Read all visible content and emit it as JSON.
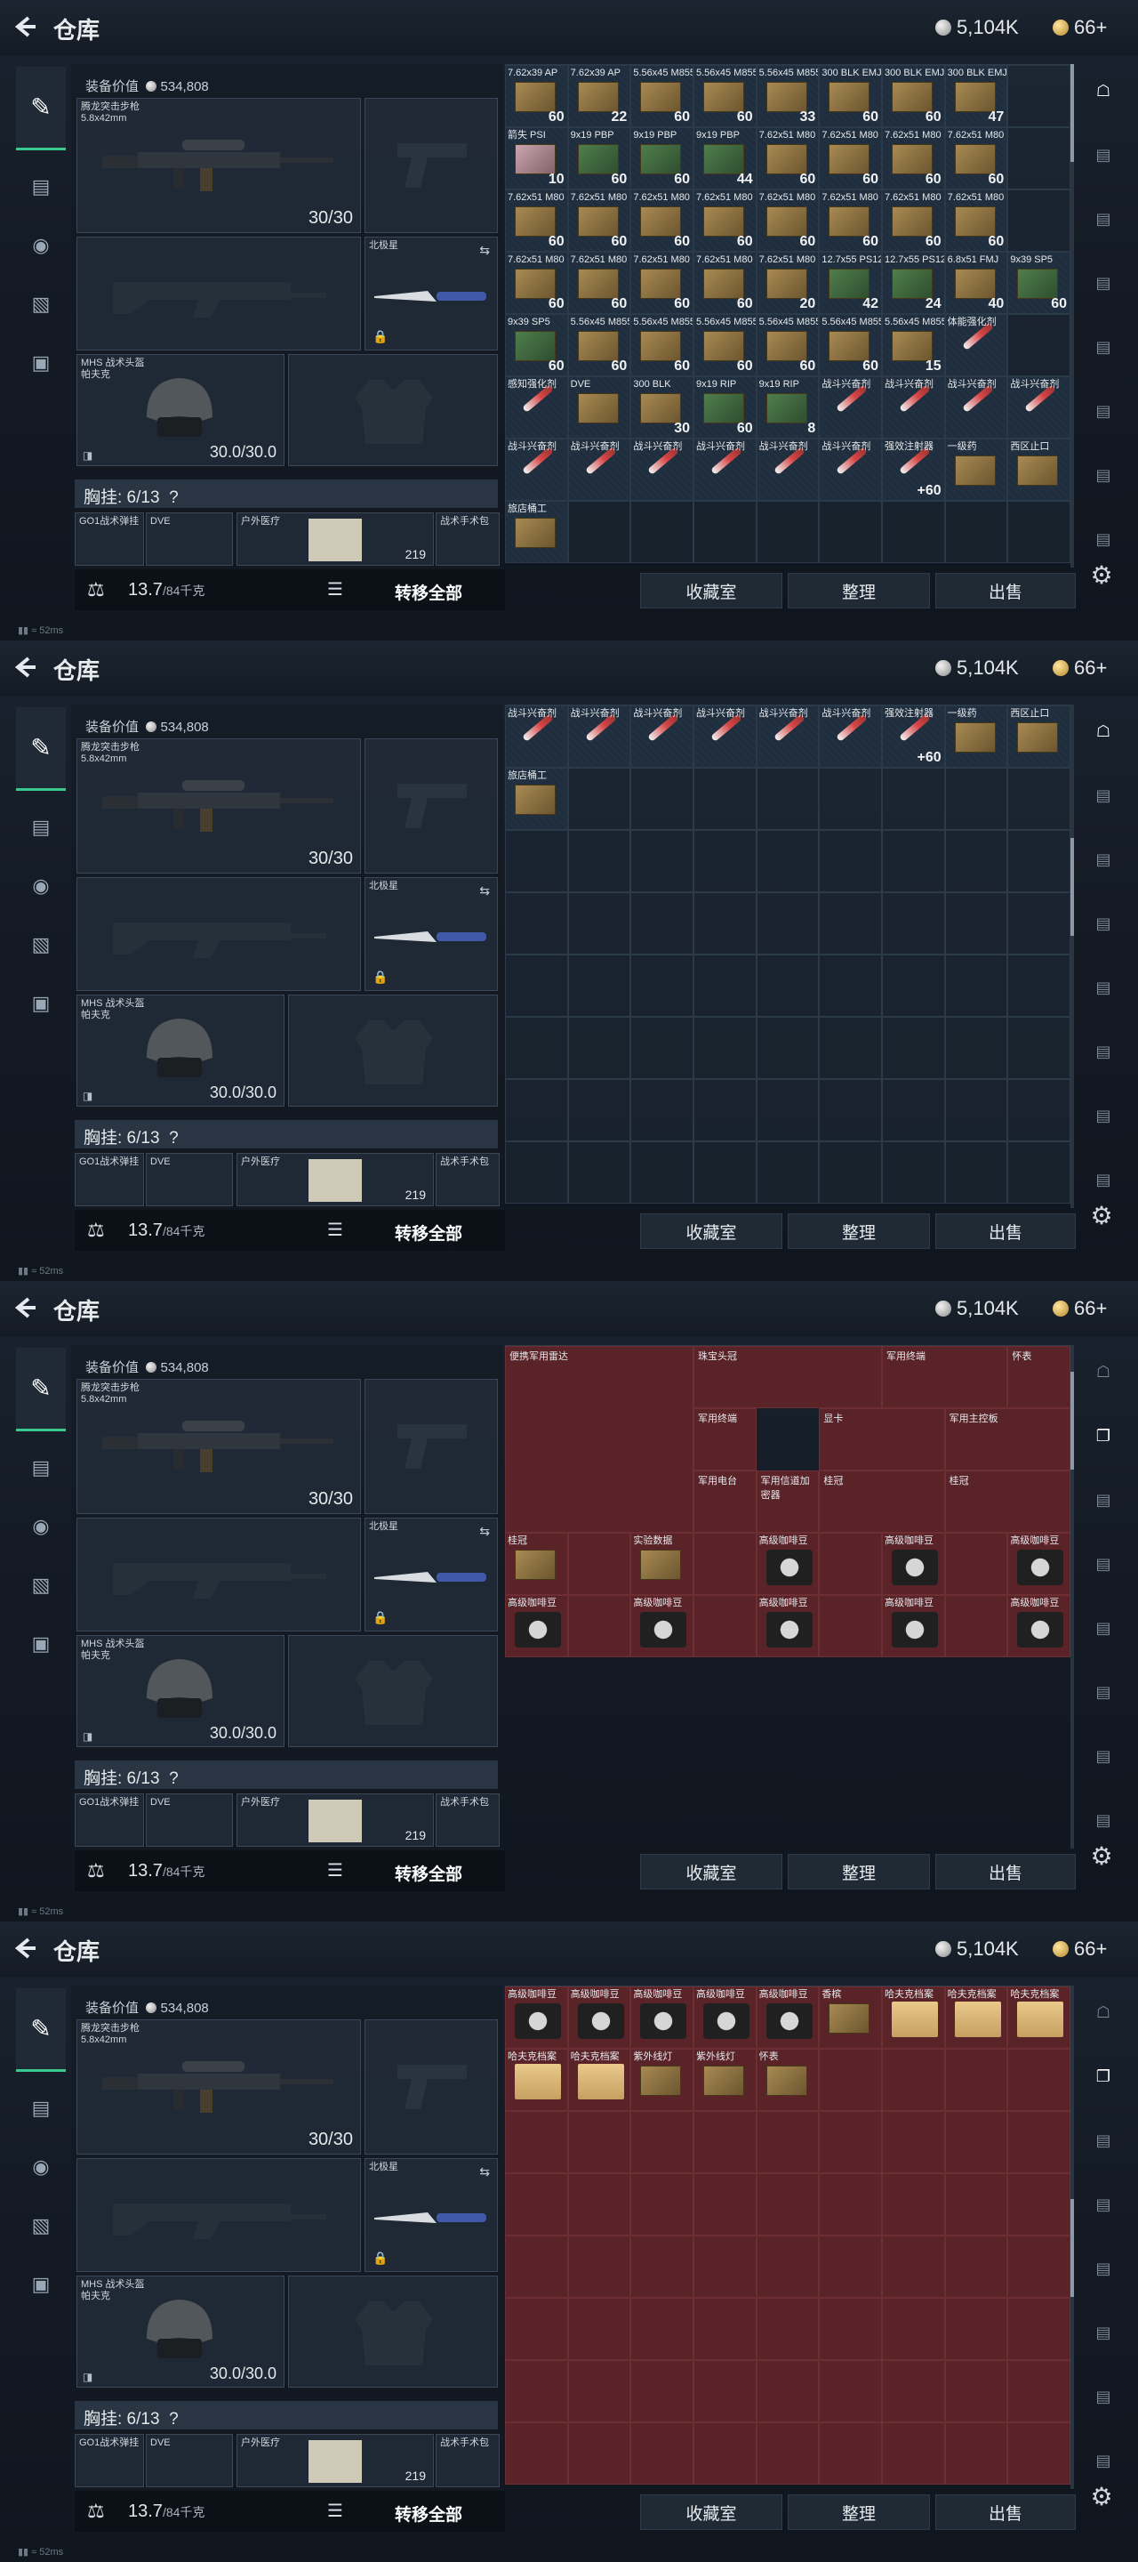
{
  "header": {
    "title": "仓库",
    "silver": "5,104K",
    "gold": "66+"
  },
  "loadout": {
    "value_label": "装备价值",
    "value": "534,808",
    "rifle_name": "腾龙突击步枪",
    "rifle_caliber": "5.8x42mm",
    "rifle_ammo": "30/30",
    "melee_label": "北极星",
    "helmet_name": "MHS 战术头盔",
    "helmet_sub": "帕夫克",
    "helmet_durability": "30.0/30.0",
    "chest_label": "胸挂: 6/13",
    "chest_q": "?",
    "rig_items": [
      "GO1战术弹挂",
      "DVE",
      "户外医疗",
      "战术手术包"
    ],
    "rig_count": "219",
    "weight": "13.7",
    "weight_max": "/84千克",
    "transfer_all": "转移全部"
  },
  "buttons": {
    "collection": "收藏室",
    "sort": "整理",
    "sell": "出售"
  },
  "status": {
    "ping": "52ms"
  },
  "panels": [
    {
      "cells": [
        [
          "7.62x39 AP",
          "60"
        ],
        [
          "7.62x39 AP",
          "22"
        ],
        [
          "5.56x45 M855",
          "60"
        ],
        [
          "5.56x45 M855",
          "60"
        ],
        [
          "5.56x45 M855",
          "33"
        ],
        [
          "300 BLK EMJ",
          "60"
        ],
        [
          "300 BLK EMJ",
          "60"
        ],
        [
          "300 BLK EMJ",
          "47"
        ],
        [
          "",
          ""
        ],
        [
          "箭失 PSI",
          "10"
        ],
        [
          "9x19 PBP",
          "60"
        ],
        [
          "9x19 PBP",
          "60"
        ],
        [
          "9x19 PBP",
          "44"
        ],
        [
          "7.62x51 M80",
          "60"
        ],
        [
          "7.62x51 M80",
          "60"
        ],
        [
          "7.62x51 M80",
          "60"
        ],
        [
          "7.62x51 M80",
          "60"
        ],
        [
          "",
          ""
        ],
        [
          "7.62x51 M80",
          "60"
        ],
        [
          "7.62x51 M80",
          "60"
        ],
        [
          "7.62x51 M80",
          "60"
        ],
        [
          "7.62x51 M80",
          "60"
        ],
        [
          "7.62x51 M80",
          "60"
        ],
        [
          "7.62x51 M80",
          "60"
        ],
        [
          "7.62x51 M80",
          "60"
        ],
        [
          "7.62x51 M80",
          "60"
        ],
        [
          "",
          ""
        ],
        [
          "7.62x51 M80",
          "60"
        ],
        [
          "7.62x51 M80",
          "60"
        ],
        [
          "7.62x51 M80",
          "60"
        ],
        [
          "7.62x51 M80",
          "60"
        ],
        [
          "7.62x51 M80",
          "20"
        ],
        [
          "12.7x55 PS12",
          "42"
        ],
        [
          "12.7x55 PS12",
          "24"
        ],
        [
          "6.8x51 FMJ",
          "40"
        ],
        [
          "9x39 SP5",
          "60"
        ],
        [
          "9x39 SP5",
          "60"
        ],
        [
          "5.56x45 M855A1",
          "60"
        ],
        [
          "5.56x45 M855A1",
          "60"
        ],
        [
          "5.56x45 M855A1",
          "60"
        ],
        [
          "5.56x45 M855A1",
          "60"
        ],
        [
          "5.56x45 M855A1",
          "60"
        ],
        [
          "5.56x45 M855A1",
          "15"
        ],
        [
          "体能强化剂",
          ""
        ],
        [
          "",
          ""
        ],
        [
          "感知强化剂",
          ""
        ],
        [
          "DVE",
          ""
        ],
        [
          "300 BLK",
          "30"
        ],
        [
          "9x19 RIP",
          "60"
        ],
        [
          "9x19 RIP",
          "8"
        ],
        [
          "战斗兴奋剂",
          ""
        ],
        [
          "战斗兴奋剂",
          ""
        ],
        [
          "战斗兴奋剂",
          ""
        ],
        [
          "战斗兴奋剂",
          ""
        ],
        [
          "战斗兴奋剂",
          ""
        ],
        [
          "战斗兴奋剂",
          ""
        ],
        [
          "战斗兴奋剂",
          ""
        ],
        [
          "战斗兴奋剂",
          ""
        ],
        [
          "战斗兴奋剂",
          ""
        ],
        [
          "战斗兴奋剂",
          ""
        ],
        [
          "强效注射器",
          "+60"
        ],
        [
          "一级药",
          ""
        ],
        [
          "西区止口",
          ""
        ],
        [
          "旅店桶工",
          ""
        ],
        [
          "",
          ""
        ],
        [
          "",
          ""
        ],
        [
          "",
          ""
        ],
        [
          "",
          ""
        ],
        [
          "",
          ""
        ],
        [
          "",
          ""
        ],
        [
          "",
          ""
        ],
        [
          "",
          ""
        ]
      ]
    },
    {
      "cells": [
        [
          "战斗兴奋剂",
          ""
        ],
        [
          "战斗兴奋剂",
          ""
        ],
        [
          "战斗兴奋剂",
          ""
        ],
        [
          "战斗兴奋剂",
          ""
        ],
        [
          "战斗兴奋剂",
          ""
        ],
        [
          "战斗兴奋剂",
          ""
        ],
        [
          "强效注射器",
          "+60"
        ],
        [
          "一级药",
          ""
        ],
        [
          "西区止口",
          ""
        ],
        [
          "旅店桶工",
          ""
        ]
      ]
    },
    {
      "big": [
        {
          "label": "便携军用雷达"
        },
        {
          "label": "珠宝头冠"
        },
        {
          "label": "军用终端"
        },
        {
          "label": "怀表"
        },
        {
          "label": "军用终端"
        },
        {
          "label": "显卡"
        },
        {
          "label": "军用主控板"
        },
        {
          "label": "军用电台"
        },
        {
          "label": "军用信道加密器"
        },
        {
          "label": "桂冠"
        },
        {
          "label": "桂冠"
        }
      ],
      "cells": [
        [
          "桂冠",
          ""
        ],
        [
          "",
          ""
        ],
        [
          "实验数据",
          ""
        ],
        [
          "",
          ""
        ],
        [
          "高级咖啡豆",
          ""
        ],
        [
          "",
          ""
        ],
        [
          "高级咖啡豆",
          ""
        ],
        [
          "",
          ""
        ],
        [
          "高级咖啡豆",
          ""
        ],
        [
          "高级咖啡豆",
          ""
        ],
        [
          "",
          ""
        ],
        [
          "高级咖啡豆",
          ""
        ],
        [
          "",
          ""
        ],
        [
          "高级咖啡豆",
          ""
        ],
        [
          "",
          ""
        ],
        [
          "高级咖啡豆",
          ""
        ],
        [
          "",
          ""
        ],
        [
          "高级咖啡豆",
          ""
        ]
      ]
    },
    {
      "cells": [
        [
          "高级咖啡豆",
          ""
        ],
        [
          "高级咖啡豆",
          ""
        ],
        [
          "高级咖啡豆",
          ""
        ],
        [
          "高级咖啡豆",
          ""
        ],
        [
          "高级咖啡豆",
          ""
        ],
        [
          "香槟",
          ""
        ],
        [
          "哈夫克档案",
          ""
        ],
        [
          "哈夫克档案",
          ""
        ],
        [
          "哈夫克档案",
          ""
        ],
        [
          "哈夫克档案",
          ""
        ],
        [
          "哈夫克档案",
          ""
        ],
        [
          "紫外线灯",
          ""
        ],
        [
          "紫外线灯",
          ""
        ],
        [
          "怀表",
          ""
        ]
      ]
    }
  ]
}
